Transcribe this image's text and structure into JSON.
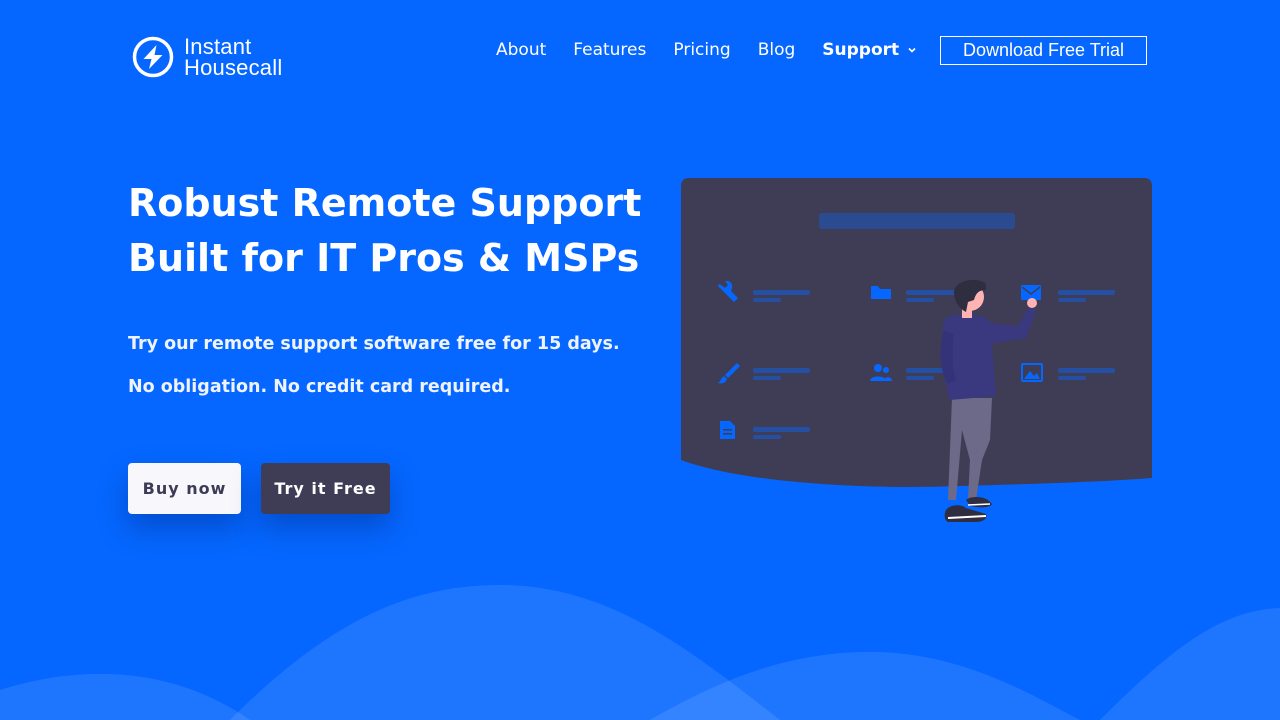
{
  "brand": {
    "line1": "Instant",
    "line2": "Housecall"
  },
  "nav": {
    "items": [
      {
        "label": "About"
      },
      {
        "label": "Features"
      },
      {
        "label": "Pricing"
      },
      {
        "label": "Blog"
      },
      {
        "label": "Support"
      }
    ],
    "cta_label": "Download Free Trial"
  },
  "hero": {
    "title_line1": "Robust Remote Support",
    "title_line2": "Built for IT Pros & MSPs",
    "paragraph1": "Try our remote support software free for 15 days.",
    "paragraph2": "No obligation. No credit card required.",
    "buy_label": "Buy now",
    "try_label": "Try it Free"
  },
  "colors": {
    "background": "#0567ff",
    "panel": "#3f3d56",
    "accent_blue": "#0567ff",
    "button_light": "#f7f7fc"
  },
  "illustration": {
    "icons": [
      "wrench-icon",
      "folder-icon",
      "email-icon",
      "brush-icon",
      "users-icon",
      "image-icon",
      "document-icon"
    ]
  }
}
